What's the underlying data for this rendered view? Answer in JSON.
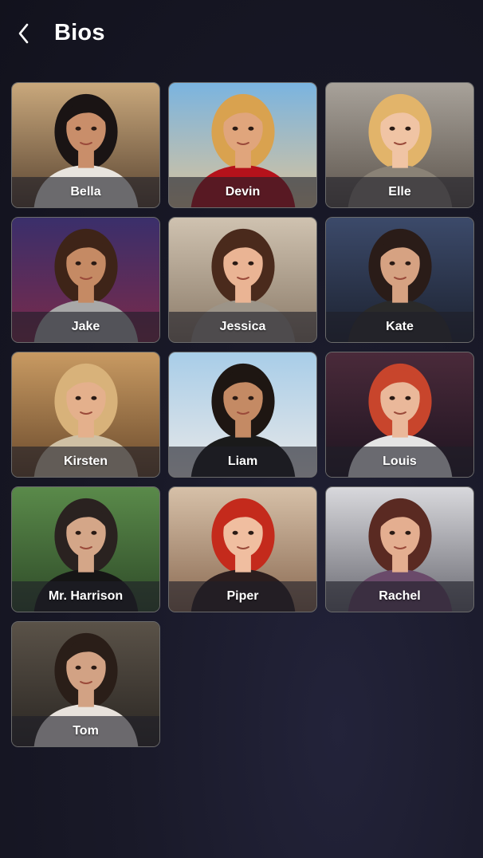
{
  "header": {
    "title": "Bios",
    "back_icon": "chevron-left-icon"
  },
  "bios": [
    {
      "name": "Bella",
      "bg": "#c9a87c",
      "bg2": "#5a4532",
      "hair": "#1a1414",
      "skin": "#c98e6a",
      "top": "#e8e4de"
    },
    {
      "name": "Devin",
      "bg": "#7ab4e0",
      "bg2": "#d9c39c",
      "hair": "#d9a24f",
      "skin": "#e0a57c",
      "top": "#b5121b"
    },
    {
      "name": "Elle",
      "bg": "#a8a29a",
      "bg2": "#5c544c",
      "hair": "#e2b46a",
      "skin": "#f0c4a4",
      "top": "#8a8276"
    },
    {
      "name": "Jake",
      "bg": "#3a2f6b",
      "bg2": "#7a2a4a",
      "hair": "#3e2418",
      "skin": "#c58a64",
      "top": "#a8a8a8"
    },
    {
      "name": "Jessica",
      "bg": "#cfc2b0",
      "bg2": "#8a7a68",
      "hair": "#4a2a1c",
      "skin": "#eab494",
      "top": "#9c9488"
    },
    {
      "name": "Kate",
      "bg": "#3c4a6a",
      "bg2": "#1c2230",
      "hair": "#2a1c18",
      "skin": "#d6a282",
      "top": "#2a2a2a"
    },
    {
      "name": "Kirsten",
      "bg": "#c89a62",
      "bg2": "#6a4a2c",
      "hair": "#d8b27a",
      "skin": "#e4b08c",
      "top": "#cfc0a4"
    },
    {
      "name": "Liam",
      "bg": "#a8cde8",
      "bg2": "#e8e8e8",
      "hair": "#1e1612",
      "skin": "#c48a64",
      "top": "#1a1a1a"
    },
    {
      "name": "Louis",
      "bg": "#4a2a3a",
      "bg2": "#1e1420",
      "hair": "#c8452c",
      "skin": "#eab89a",
      "top": "#e4e4e4"
    },
    {
      "name": "Mr. Harrison",
      "bg": "#5a8a4a",
      "bg2": "#2e4a28",
      "hair": "#2a2220",
      "skin": "#d4a688",
      "top": "#151515"
    },
    {
      "name": "Piper",
      "bg": "#d6c0a8",
      "bg2": "#8a6a52",
      "hair": "#c42a1c",
      "skin": "#f0bea0",
      "top": "#2c1e1e"
    },
    {
      "name": "Rachel",
      "bg": "#d8d8dc",
      "bg2": "#6a6a72",
      "hair": "#5a2a22",
      "skin": "#e4ae90",
      "top": "#6a4a6a"
    },
    {
      "name": "Tom",
      "bg": "#5a5248",
      "bg2": "#2a2622",
      "hair": "#2a1e18",
      "skin": "#d2a284",
      "top": "#e8e2dc"
    }
  ]
}
